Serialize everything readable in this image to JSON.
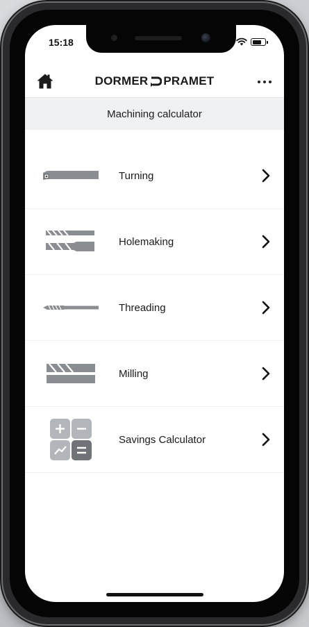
{
  "status_bar": {
    "time": "15:18"
  },
  "header": {
    "brand_left": "DORMER",
    "brand_right": "PRAMET"
  },
  "subheader": {
    "title": "Machining calculator"
  },
  "menu": {
    "items": [
      {
        "label": "Turning",
        "icon": "turning-tool-icon"
      },
      {
        "label": "Holemaking",
        "icon": "drill-icon"
      },
      {
        "label": "Threading",
        "icon": "tap-icon"
      },
      {
        "label": "Milling",
        "icon": "end-mill-icon"
      },
      {
        "label": "Savings Calculator",
        "icon": "calculator-icon"
      }
    ]
  },
  "colors": {
    "tool_gray": "#8a8d91",
    "calc_dark": "#6f7276",
    "calc_light": "#b2b5b9",
    "subheader_bg": "#f0f1f3"
  }
}
